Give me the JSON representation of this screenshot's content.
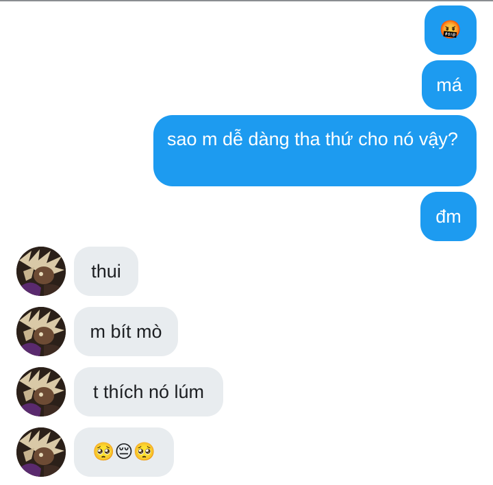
{
  "conversation": {
    "sent": [
      {
        "text": "🤬"
      },
      {
        "text": "má"
      },
      {
        "text": "sao m dễ dàng tha thứ cho nó vậy?"
      },
      {
        "text": "đm"
      }
    ],
    "received": [
      {
        "text": "thui"
      },
      {
        "text": "m bít mò"
      },
      {
        "text": "t thích nó lúm"
      },
      {
        "text": "🥺😔🥺"
      }
    ]
  },
  "colors": {
    "sent_bubble": "#1d9bf0",
    "received_bubble": "#e8ecef",
    "sent_text": "#ffffff",
    "received_text": "#1c1e21"
  },
  "icons": {
    "avatar": "contact-avatar-icon"
  }
}
